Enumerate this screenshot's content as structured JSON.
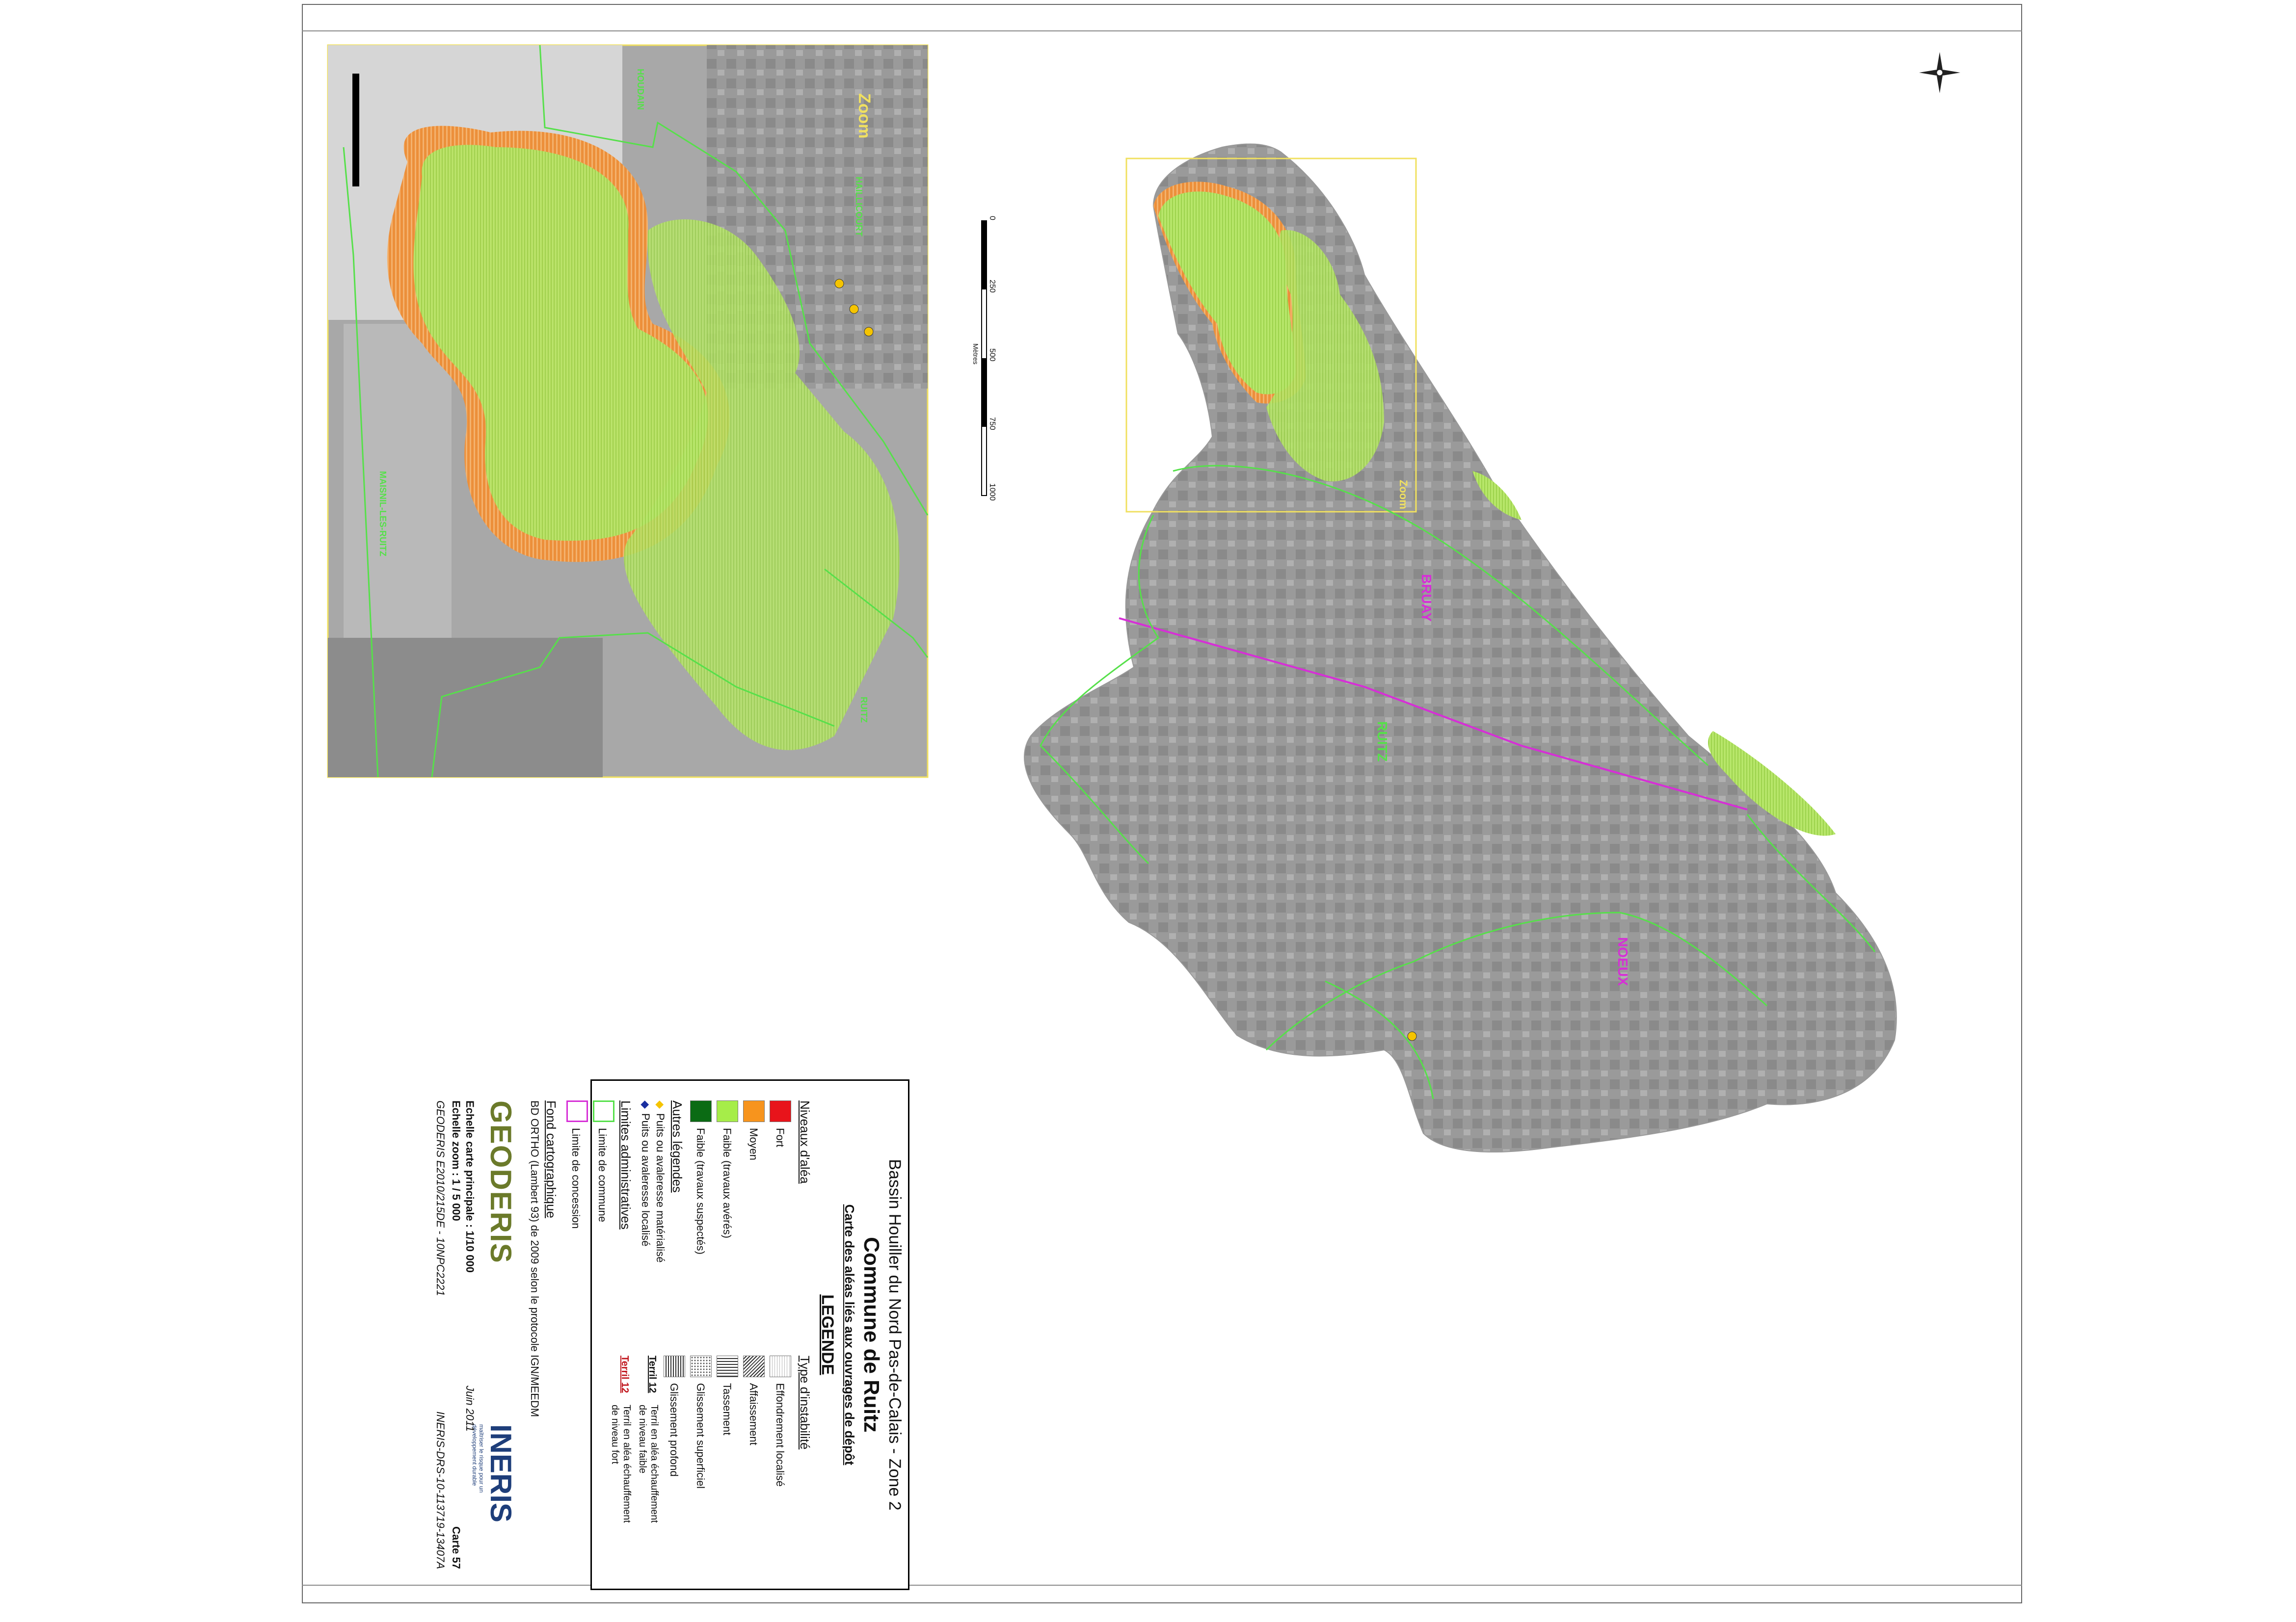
{
  "title": {
    "line1": "Bassin Houiller du Nord Pas-de-Calais - Zone 2",
    "line2": "Commune de Ruitz",
    "line3": "Carte des aléas liés aux ouvrages de dépôt"
  },
  "legend": {
    "heading": "LEGENDE",
    "niveaux_heading": "Niveaux d'aléa",
    "niveaux": [
      {
        "label": "Fort",
        "color": "#e8141b"
      },
      {
        "label": "Moyen",
        "color": "#f7941d"
      },
      {
        "label": "Faible (travaux avérés)",
        "color": "#a6ed49"
      },
      {
        "label": "Faible (travaux suspectés)",
        "color": "#0b6b14"
      }
    ],
    "instab_heading": "Type d'instabilité",
    "instab": [
      {
        "label": "Effondrement  localisé"
      },
      {
        "label": "Affaissement"
      },
      {
        "label": "Tassement"
      },
      {
        "label": "Glissement superficiel"
      },
      {
        "label": "Glissement profond"
      }
    ],
    "terril_items": [
      {
        "tag": "Terril 12",
        "text1": "Terril en aléa échauffement",
        "text2": "de niveau faible",
        "color": "#000000"
      },
      {
        "tag": "Terril 12",
        "text1": "Terril en aléa échauffement",
        "text2": "de niveau fort",
        "color": "#c0141b"
      }
    ],
    "autres_heading": "Autres légendes",
    "autres": [
      {
        "label": "Puits ou avaleresse matérialisé",
        "color": "#f5c400"
      },
      {
        "label": "Puits ou avaleresse localisé",
        "color": "#1a2fa0"
      }
    ],
    "limites_heading": "Limites administratives",
    "limites": [
      {
        "label": "Limite de commune",
        "color": "#56e04a"
      },
      {
        "label": "Limite de concession",
        "color": "#d62fd6"
      }
    ],
    "fond_heading": "Fond cartographique",
    "fond_text": "BD ORTHO (Lambert 93) de 2009 selon le protocole IGN/MEEDM"
  },
  "logos": {
    "geoderis": "GEODERIS",
    "ineris": "INERIS",
    "ineris_sub": "maîtriser le risque pour un développement durable"
  },
  "footer": {
    "scale_main": "Echelle carte principale : 1/10 000",
    "scale_zoom": "Echelle zoom : 1 / 5 000",
    "ref_left": "GEODERIS E2010/215DE - 10NPC2221",
    "date": "Juin 2011",
    "carte": "Carte 57",
    "ref_right": "INERIS-DRS-10-113719-13407A"
  },
  "map": {
    "communes": [
      "BRUAY",
      "RUITZ",
      "NOEUX"
    ],
    "zoom_label": "Zoom",
    "zoom_communes": [
      "HOUDAIN",
      "HAILLICOURT",
      "MAISNIL-LES-RUITZ",
      "RUITZ"
    ],
    "scale_ticks": [
      "0",
      "250",
      "500",
      "750",
      "1000"
    ],
    "scale_unit": "Mètres",
    "colors": {
      "commune_line": "#56e04a",
      "concession_line": "#d62fd6",
      "zoom_box": "#f0e060"
    }
  }
}
